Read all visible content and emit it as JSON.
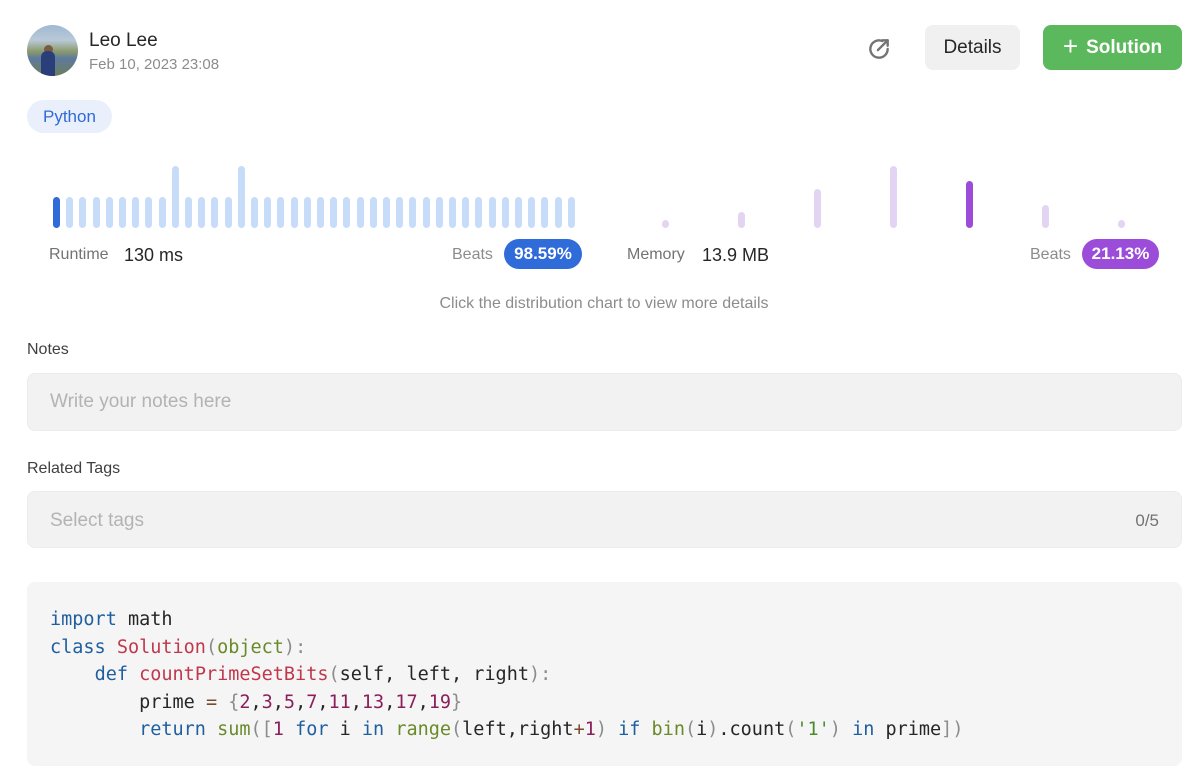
{
  "user": {
    "name": "Leo Lee",
    "date": "Feb 10, 2023 23:08"
  },
  "toolbar": {
    "share_icon": "share-icon",
    "details_label": "Details",
    "solution_label": "Solution",
    "solution_icon": "plus-icon"
  },
  "language_tag": "Python",
  "runtime": {
    "label": "Runtime",
    "value": "130 ms",
    "beats_label": "Beats",
    "beats_value": "98.59%",
    "color": "#2f6bd9",
    "highlight_index": 0
  },
  "memory": {
    "label": "Memory",
    "value": "13.9 MB",
    "beats_label": "Beats",
    "beats_value": "21.13%",
    "color": "#9b4dd9",
    "highlight_index": 4
  },
  "hint": "Click the distribution chart to view more details",
  "notes": {
    "label": "Notes",
    "placeholder": "Write your notes here"
  },
  "related_tags": {
    "label": "Related Tags",
    "placeholder": "Select tags",
    "count": "0/5"
  },
  "code": {
    "language": "Python",
    "lines": [
      "import math",
      "class Solution(object):",
      "    def countPrimeSetBits(self, left, right):",
      "        prime = {2,3,5,7,11,13,17,19}",
      "        return sum([1 for i in range(left,right+1) if bin(i).count('1') in prime])"
    ]
  },
  "chart_data": [
    {
      "type": "bar",
      "series_role": "runtime distribution",
      "values": [
        1,
        1,
        1,
        1,
        1,
        1,
        1,
        1,
        1,
        2,
        1,
        1,
        1,
        1,
        2,
        1,
        1,
        1,
        1,
        1,
        1,
        1,
        1,
        1,
        1,
        1,
        1,
        1,
        1,
        1,
        1,
        1,
        1,
        1,
        1,
        1,
        1,
        1,
        1,
        1
      ],
      "highlight_index": 0,
      "ylim": [
        0,
        2
      ]
    },
    {
      "type": "bar",
      "series_role": "memory distribution",
      "values": [
        1,
        2,
        5,
        8,
        6,
        3,
        1
      ],
      "highlight_index": 4,
      "ylim": [
        0,
        8
      ]
    }
  ]
}
